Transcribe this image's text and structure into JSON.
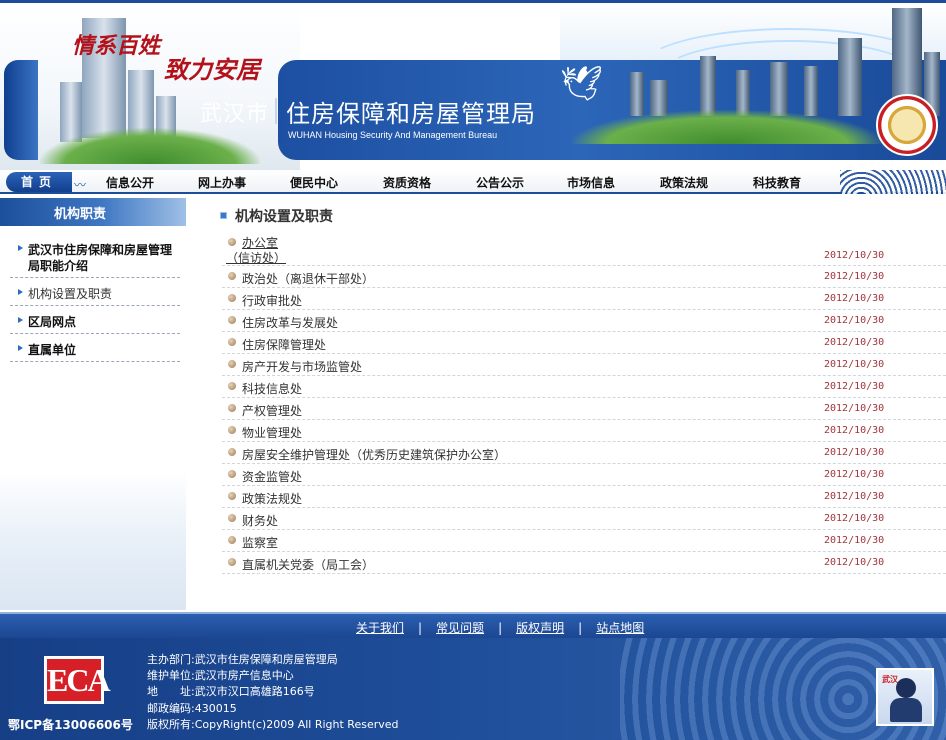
{
  "header": {
    "slogan_line1": "情系百姓",
    "slogan_line2": "致力安居",
    "city": "武汉市",
    "bureau": "住房保障和房屋管理局",
    "bureau_en": "WUHAN Housing Security And Management Bureau"
  },
  "nav": {
    "home": "首页",
    "items": [
      "信息公开",
      "网上办事",
      "便民中心",
      "资质资格",
      "公告公示",
      "市场信息",
      "政策法规",
      "科技教育"
    ]
  },
  "sidebar": {
    "heading": "机构职责",
    "items": [
      "武汉市住房保障和房屋管理局职能介绍",
      "机构设置及职责",
      "区局网点",
      "直属单位"
    ],
    "active_index": 1
  },
  "main": {
    "title": "机构设置及职责",
    "rows": [
      {
        "title": "办公室",
        "sub": "（信访处）",
        "date": "2012/10/30"
      },
      {
        "title": "政治处（离退休干部处）",
        "date": "2012/10/30"
      },
      {
        "title": "行政审批处",
        "date": "2012/10/30"
      },
      {
        "title": "住房改革与发展处",
        "date": "2012/10/30"
      },
      {
        "title": "住房保障管理处",
        "date": "2012/10/30"
      },
      {
        "title": "房产开发与市场监管处",
        "date": "2012/10/30"
      },
      {
        "title": "科技信息处",
        "date": "2012/10/30"
      },
      {
        "title": "产权管理处",
        "date": "2012/10/30"
      },
      {
        "title": "物业管理处",
        "date": "2012/10/30"
      },
      {
        "title": "房屋安全维护管理处（优秀历史建筑保护办公室）",
        "date": "2012/10/30"
      },
      {
        "title": "资金监管处",
        "date": "2012/10/30"
      },
      {
        "title": "政策法规处",
        "date": "2012/10/30"
      },
      {
        "title": "财务处",
        "date": "2012/10/30"
      },
      {
        "title": "监察室",
        "date": "2012/10/30"
      },
      {
        "title": "直属机关党委（局工会）",
        "date": "2012/10/30"
      }
    ]
  },
  "footer": {
    "links": [
      "关于我们",
      "常见问题",
      "版权声明",
      "站点地图"
    ],
    "separator": "|",
    "eca_logo": "ECA",
    "icp": "鄂ICP备13006606号",
    "info": [
      "主办部门:武汉市住房保障和房屋管理局",
      "维护单位:武汉市房产信息中心",
      "地　　址:武汉市汉口高雄路166号",
      "邮政编码:430015",
      "版权所有:CopyRight(c)2009 All Right Reserved"
    ],
    "badge_text": "武汉"
  }
}
